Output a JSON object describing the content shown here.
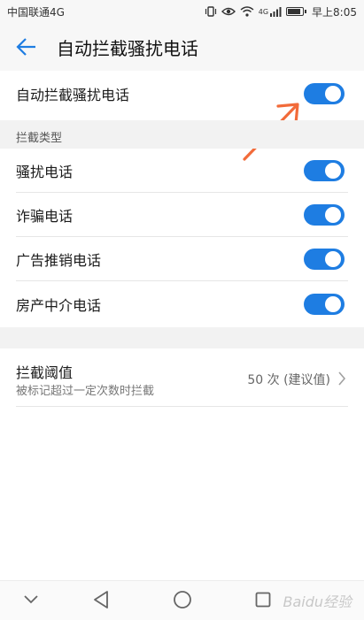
{
  "status_bar": {
    "carrier": "中国联通4G",
    "network_badge": "4G",
    "time": "早上8:05",
    "icons": [
      "vibrate-icon",
      "eye-icon",
      "wifi-icon",
      "signal-icon",
      "battery-icon"
    ],
    "battery_level": 0.95
  },
  "header": {
    "title": "自动拦截骚扰电话",
    "back_icon": "arrow-left-icon"
  },
  "master_toggle": {
    "label": "自动拦截骚扰电话",
    "on": true
  },
  "section": {
    "title": "拦截类型"
  },
  "block_types": [
    {
      "label": "骚扰电话",
      "on": true
    },
    {
      "label": "诈骗电话",
      "on": true
    },
    {
      "label": "广告推销电话",
      "on": true
    },
    {
      "label": "房产中介电话",
      "on": true
    }
  ],
  "threshold": {
    "title": "拦截阈值",
    "subtitle": "被标记超过一定次数时拦截",
    "value": "50 次 (建议值)"
  },
  "nav": {
    "icons": [
      "chevron-down-icon",
      "back-triangle-icon",
      "home-circle-icon",
      "recents-square-icon"
    ]
  },
  "watermark": "Baidu经验",
  "colors": {
    "accent": "#1e7de2",
    "annotation": "#f26b3a",
    "section_bg": "#f2f2f2"
  }
}
